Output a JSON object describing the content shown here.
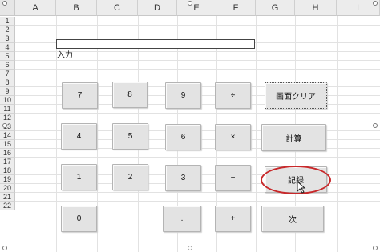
{
  "columns": [
    "A",
    "B",
    "C",
    "D",
    "E",
    "F",
    "G",
    "H",
    "I"
  ],
  "rows": [
    "1",
    "2",
    "3",
    "4",
    "5",
    "6",
    "7",
    "8",
    "9",
    "10",
    "11",
    "12",
    "13",
    "14",
    "15",
    "16",
    "17",
    "18",
    "19",
    "20",
    "21",
    "22"
  ],
  "input_label": "入力",
  "input_value": "",
  "buttons": {
    "seven": "7",
    "eight": "8",
    "nine": "9",
    "divide": "÷",
    "clear": "画面クリア",
    "four": "4",
    "five": "5",
    "six": "6",
    "multiply": "×",
    "calculate": "計算",
    "one": "1",
    "two": "2",
    "three": "3",
    "minus": "−",
    "record": "記録",
    "zero": "0",
    "dot": ".",
    "plus": "+",
    "next": "次"
  },
  "colors": {
    "annotation_ellipse": "#c8282a",
    "button_face": "#e3e3e3",
    "grid": "#e2e2e2"
  }
}
